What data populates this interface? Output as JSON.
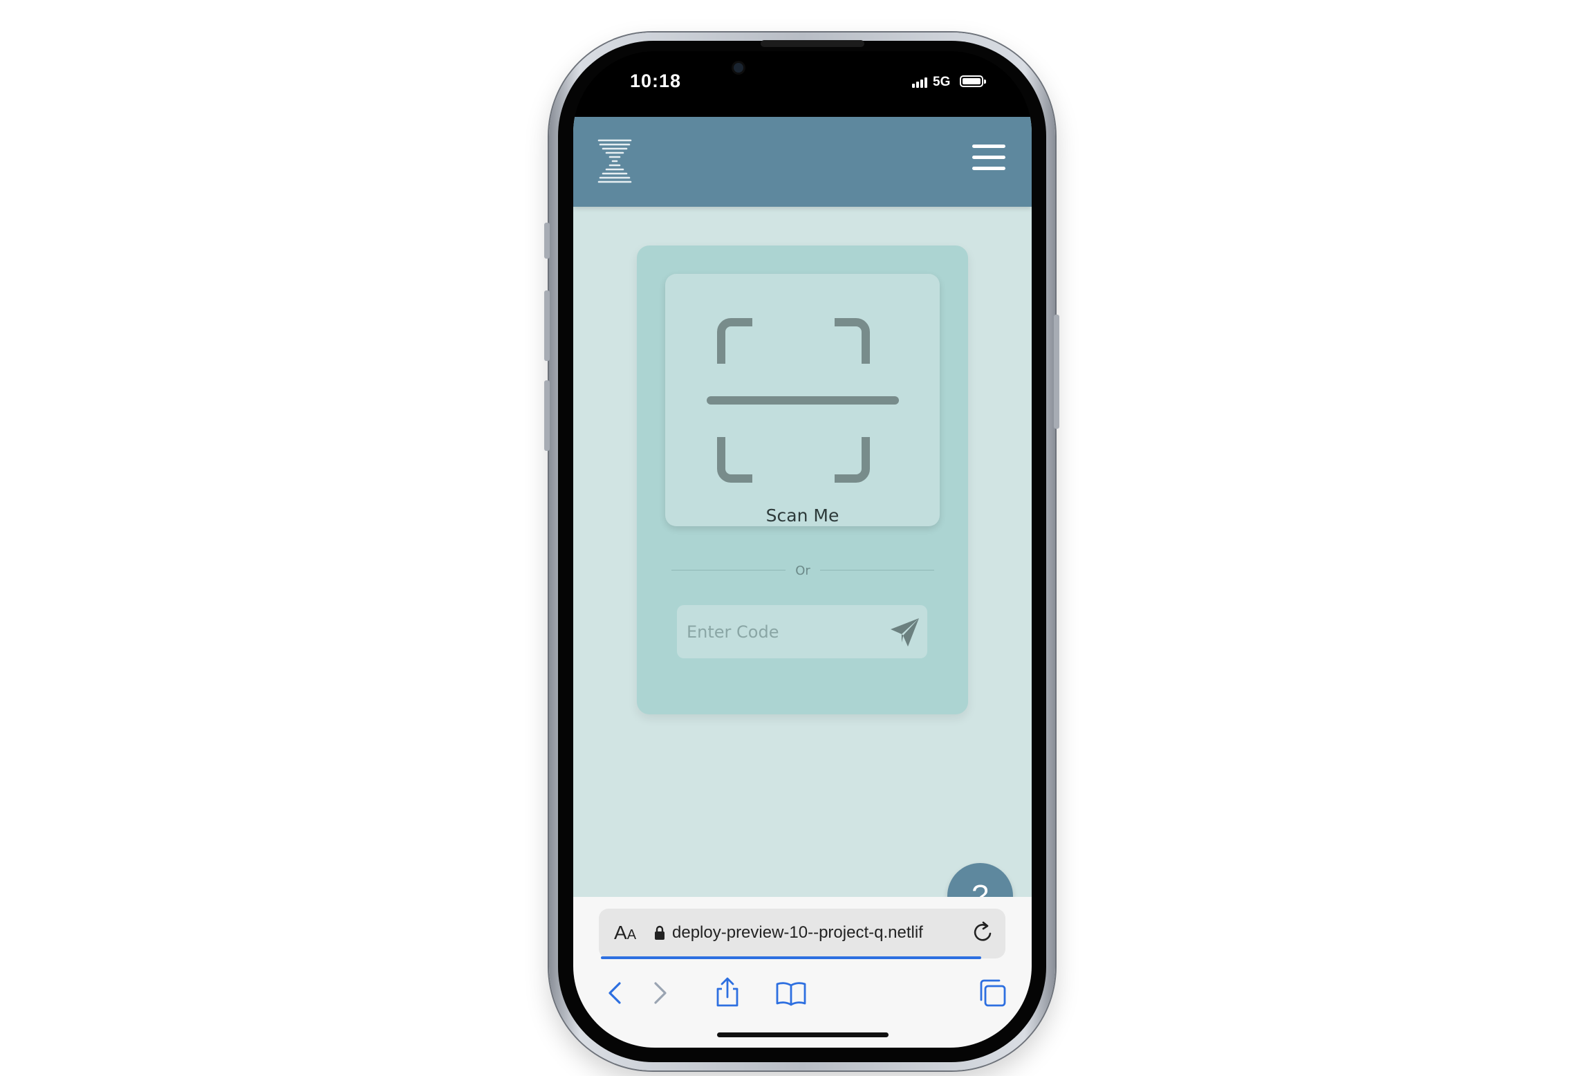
{
  "status_bar": {
    "time": "10:18",
    "network": "5G",
    "icons": [
      "signal-icon",
      "battery-icon"
    ]
  },
  "header": {
    "logo_icon": "hourglass-logo-icon",
    "menu_icon": "hamburger-menu-icon",
    "color": "#5e889e"
  },
  "scan_card": {
    "scan_icon": "scan-frame-icon",
    "label": "Scan Me",
    "divider_text": "Or",
    "code_input": {
      "value": "",
      "placeholder": "Enter Code"
    },
    "send_icon": "paper-plane-icon"
  },
  "help_button": {
    "label": "?"
  },
  "browser": {
    "aa_big": "A",
    "aa_small": "A",
    "url": "deploy-preview-10--project-q.netlif",
    "toolbar_icons": [
      "back-icon",
      "forward-icon",
      "share-icon",
      "bookmarks-icon",
      "tabs-icon"
    ],
    "accent": "#2d6fe0"
  },
  "colors": {
    "page_background": "#d1e4e3",
    "card": "#acd4d2",
    "inner_card": "#c2dedd"
  }
}
